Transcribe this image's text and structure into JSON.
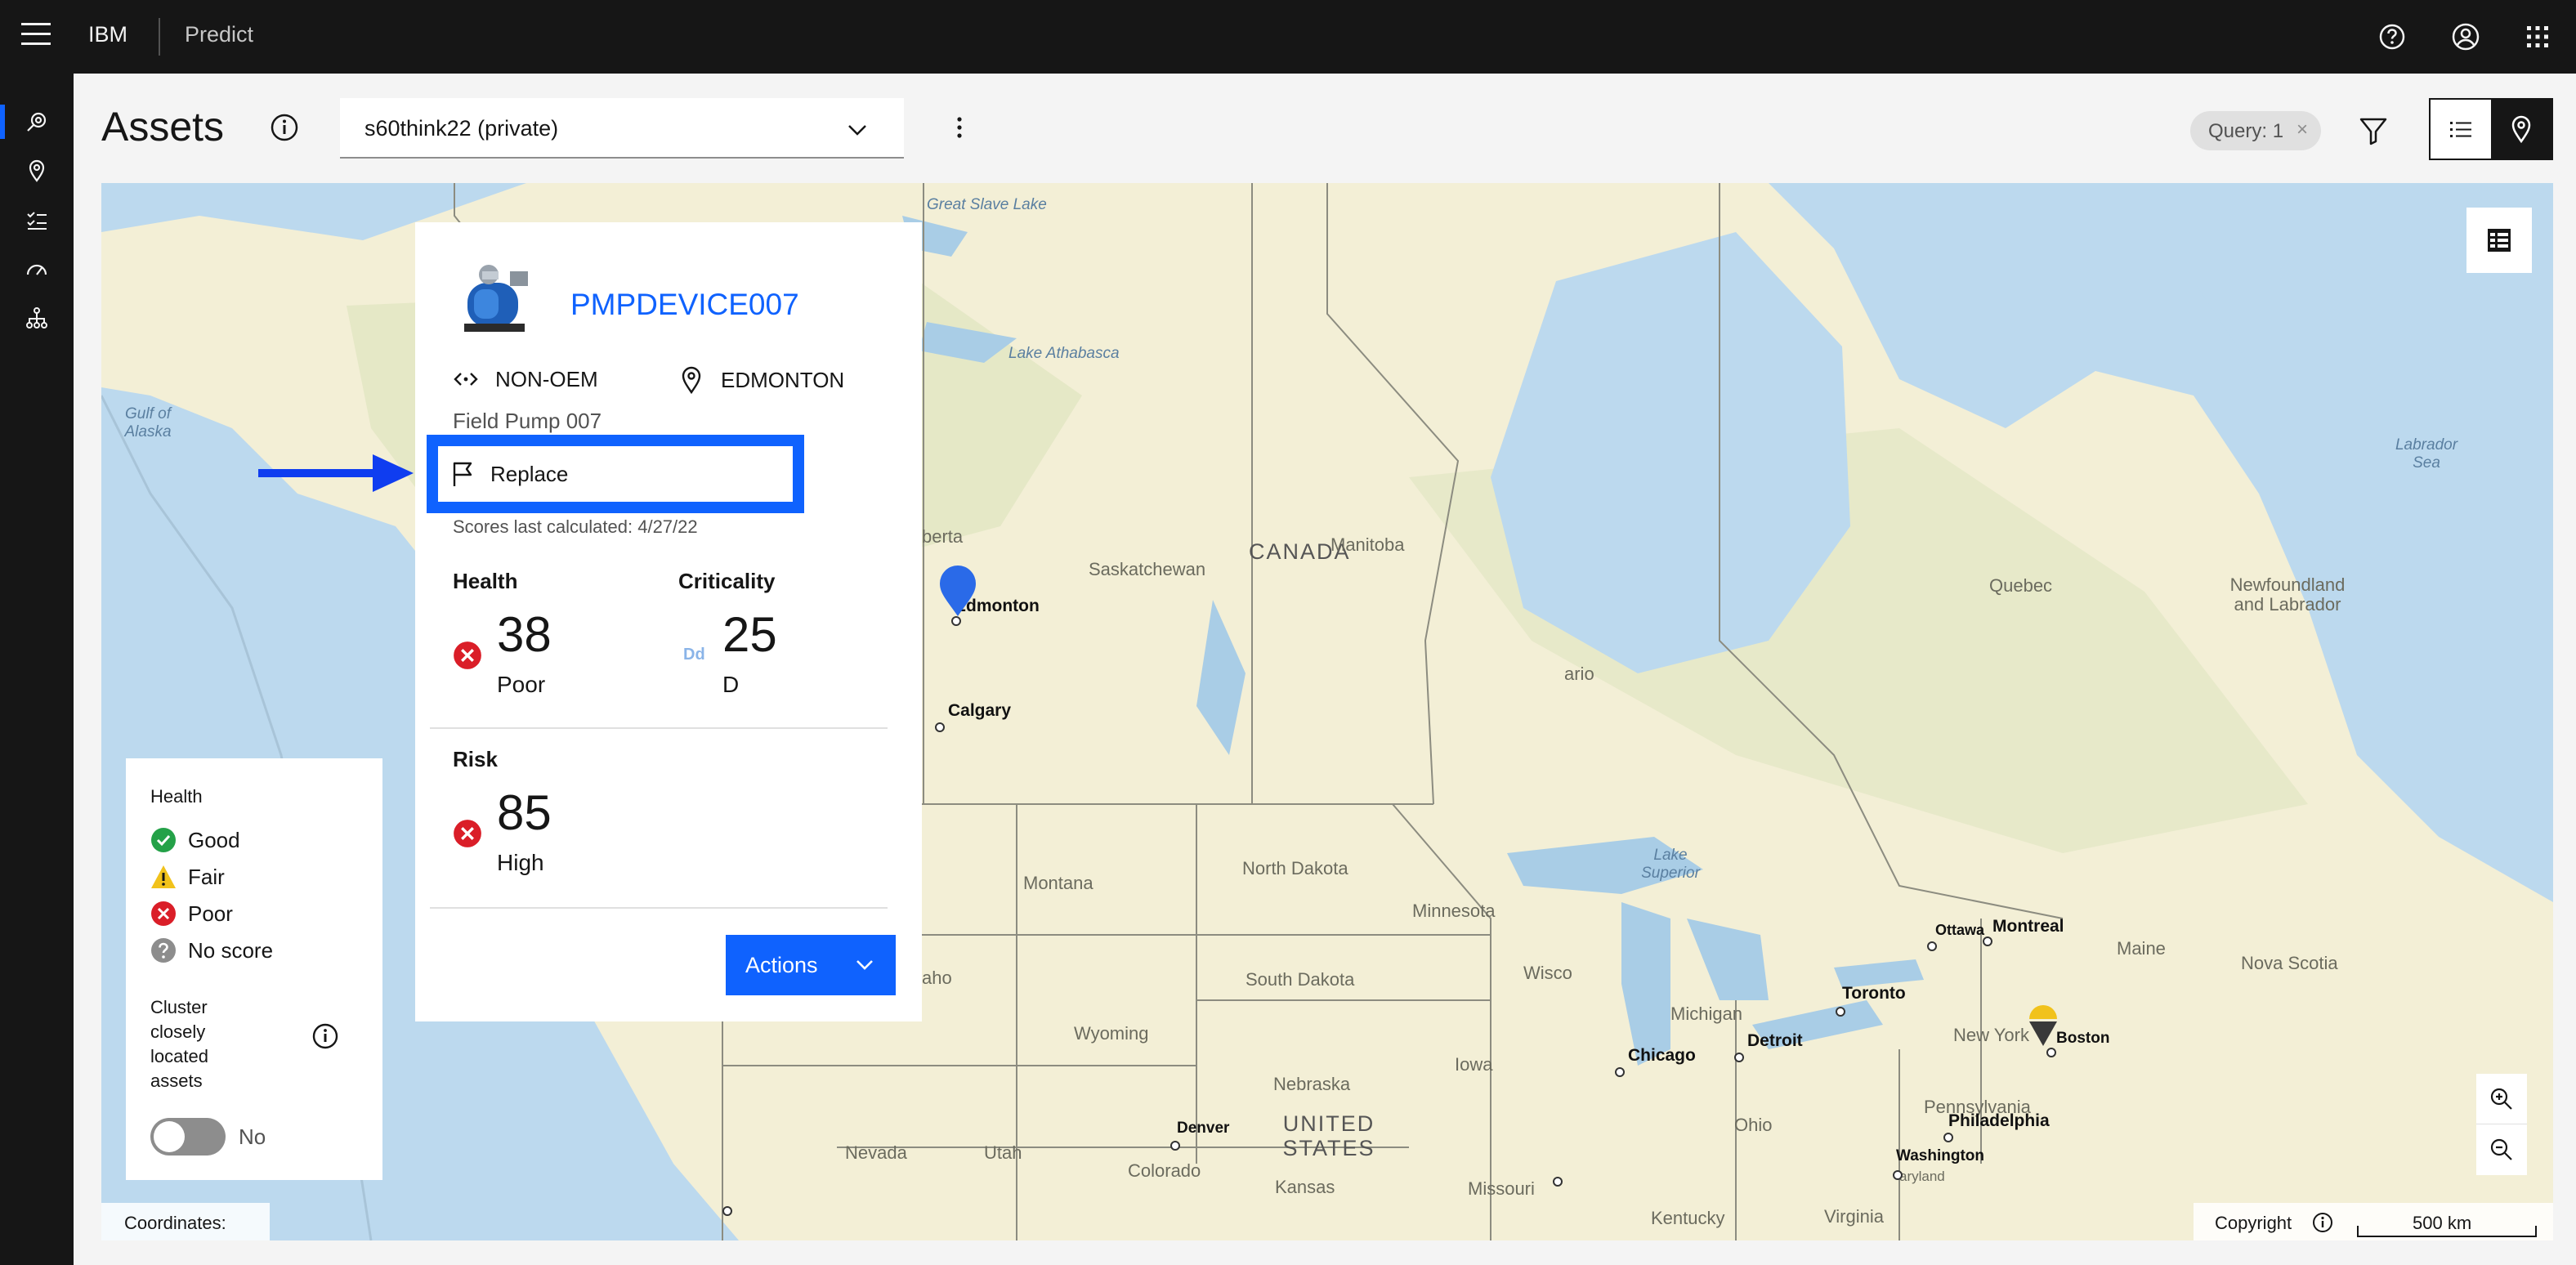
{
  "topbar": {
    "brand": "IBM",
    "product": "Predict",
    "icons": [
      "menu-icon",
      "help-icon",
      "user-avatar-icon",
      "app-switcher-icon"
    ]
  },
  "rail": {
    "items": [
      {
        "icon": "assets-icon",
        "active": true
      },
      {
        "icon": "location-icon",
        "active": false
      },
      {
        "icon": "checklist-icon",
        "active": false
      },
      {
        "icon": "dashboard-gauge-icon",
        "active": false
      },
      {
        "icon": "hierarchy-icon",
        "active": false
      }
    ]
  },
  "header": {
    "title": "Assets",
    "org_select_value": "s60think22 (private)",
    "query_tag": "Query: 1",
    "query_tag_close": "×"
  },
  "map": {
    "labels": {
      "great_slave_lake": "Great Slave Lake",
      "lake_athabasca": "Lake Athabasca",
      "gulf_of_alaska": "Gulf of Alaska",
      "labrador_sea": "Labrador Sea",
      "canada": "CANADA",
      "saskatchewan": "Saskatchewan",
      "manitoba": "Manitoba",
      "alberta": "berta",
      "quebec": "Quebec",
      "newfoundland": "Newfoundland and Labrador",
      "ontario": "ario",
      "lake_superior": "Lake Superior",
      "north_dakota": "North Dakota",
      "south_dakota": "South Dakota",
      "montana": "Montana",
      "idaho": "aho",
      "wyoming": "Wyoming",
      "minnesota": "Minnesota",
      "wisconsin": "Wisco",
      "michigan": "Michigan",
      "iowa": "Iowa",
      "nebraska": "Nebraska",
      "united_states": "UNITED STATES",
      "nevada": "Nevada",
      "utah": "Utah",
      "colorado": "Colorado",
      "kansas": "Kansas",
      "missouri": "Missouri",
      "ohio": "Ohio",
      "pennsylvania": "Pennsylvania",
      "new_york": "New York",
      "maine": "Maine",
      "nova_scotia": "Nova Scotia",
      "kentucky": "Kentucky",
      "virginia": "Virginia",
      "maryland": "aryland"
    },
    "cities": {
      "edmonton": "Edmonton",
      "calgary": "Calgary",
      "chicago": "Chicago",
      "detroit": "Detroit",
      "toronto": "Toronto",
      "ottawa": "Ottawa",
      "montreal": "Montreal",
      "boston": "Boston",
      "philadelphia": "Philadelphia",
      "washington": "Washington",
      "denver": "Denver"
    },
    "coordinates_label": "Coordinates:",
    "copyright": "Copyright",
    "scale": "500 km"
  },
  "legend": {
    "heading": "Health",
    "items": [
      {
        "label": "Good",
        "color": "#24a148",
        "icon": "checkmark-filled-icon"
      },
      {
        "label": "Fair",
        "color": "#f1c21b",
        "icon": "warning-filled-icon"
      },
      {
        "label": "Poor",
        "color": "#da1e28",
        "icon": "error-filled-icon"
      },
      {
        "label": "No score",
        "color": "#8d8d8d",
        "icon": "help-filled-icon"
      }
    ],
    "cluster_label": "Cluster closely located assets",
    "toggle_value": "No"
  },
  "card": {
    "asset_name": "PMPDEVICE007",
    "manufacturer": "NON-OEM",
    "site": "EDMONTON",
    "description": "Field Pump 007",
    "recommended_action": "Replace",
    "scores_date": "Scores last calculated: 4/27/22",
    "health": {
      "heading": "Health",
      "value": "38",
      "rating": "Poor"
    },
    "criticality": {
      "heading": "Criticality",
      "value": "25",
      "rating": "D",
      "icon_text": "Dd"
    },
    "risk": {
      "heading": "Risk",
      "value": "85",
      "rating": "High"
    },
    "actions_label": "Actions"
  },
  "colors": {
    "accent": "#0f62fe",
    "danger": "#da1e28",
    "topbar": "#161616"
  }
}
